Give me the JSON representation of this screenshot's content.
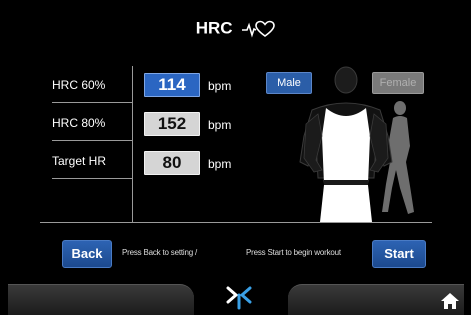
{
  "header": {
    "title": "HRC",
    "title_icon": "heart-pulse-icon"
  },
  "hr_table": {
    "rows": [
      {
        "label": "HRC 60%",
        "value": "114",
        "unit": "bpm",
        "selected": true
      },
      {
        "label": "HRC 80%",
        "value": "152",
        "unit": "bpm",
        "selected": false
      },
      {
        "label": "Target  HR",
        "value": "80",
        "unit": "bpm",
        "selected": false
      }
    ]
  },
  "gender": {
    "male_label": "Male",
    "female_label": "Female",
    "selected": "Male"
  },
  "actions": {
    "back_label": "Back",
    "back_hint": "Press Back to setting /",
    "start_hint": "Press Start to begin workout",
    "start_label": "Start"
  },
  "footer": {
    "center_icon": "brand-logo-icon",
    "home_icon": "home-icon"
  },
  "colors": {
    "accent_blue": "#2b66c2",
    "background": "#000000",
    "value_box_gray": "#d5d5d5"
  }
}
